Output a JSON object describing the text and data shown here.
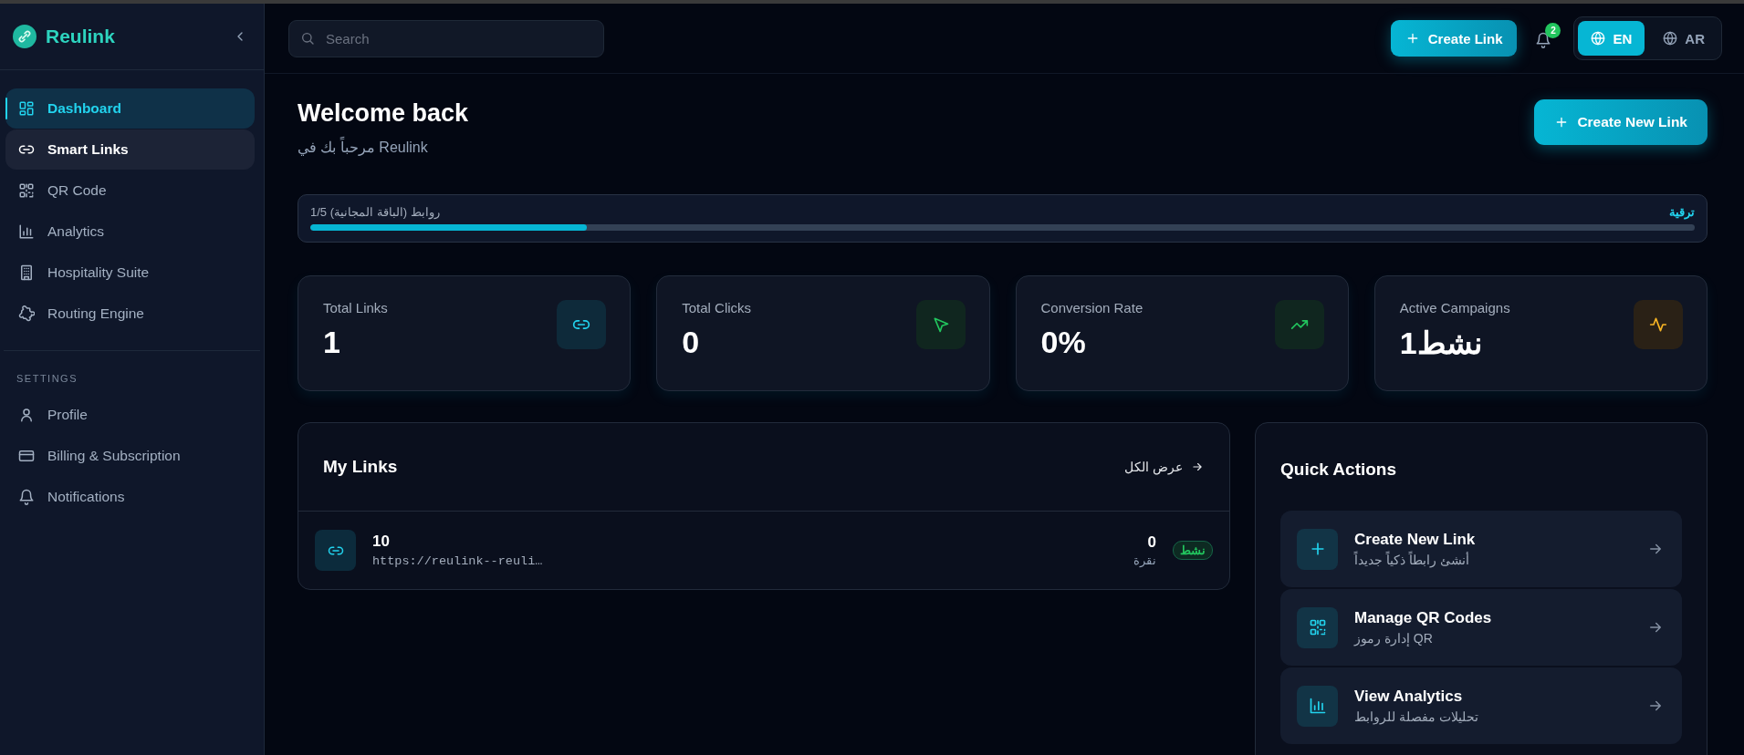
{
  "brand": {
    "name": "Reulink"
  },
  "sidebar": {
    "items": [
      {
        "label": "Dashboard",
        "selected": true,
        "hovered": false
      },
      {
        "label": "Smart Links",
        "selected": false,
        "hovered": true
      },
      {
        "label": "QR Code",
        "selected": false,
        "hovered": false
      },
      {
        "label": "Analytics",
        "selected": false,
        "hovered": false
      },
      {
        "label": "Hospitality Suite",
        "selected": false,
        "hovered": false
      },
      {
        "label": "Routing Engine",
        "selected": false,
        "hovered": false
      }
    ],
    "settings_heading": "SETTINGS",
    "settings_items": [
      {
        "label": "Profile",
        "selected": false
      },
      {
        "label": "Billing & Subscription",
        "selected": false
      },
      {
        "label": "Notifications",
        "selected": false
      }
    ]
  },
  "topbar": {
    "search": {
      "placeholder": "Search"
    },
    "create_button": "Create Link",
    "notification_count": "2",
    "languages": [
      {
        "label": "EN",
        "selected": true
      },
      {
        "label": "AR",
        "selected": false
      }
    ]
  },
  "header": {
    "title": "Welcome back",
    "subtitle": "مرحباً بك في Reulink",
    "button": "Create New Link"
  },
  "plan": {
    "label": "روابط (الباقة المجانية) 1/5",
    "upgrade": "ترقية",
    "level": 0.2
  },
  "stats": [
    {
      "label": "Total Links",
      "value": "1"
    },
    {
      "label": "Total Clicks",
      "value": "0"
    },
    {
      "label": "Conversion Rate",
      "value": "0%"
    },
    {
      "label": "Active Campaigns",
      "value": "نشط1"
    }
  ],
  "my_links": {
    "title": "My Links",
    "view_all": "عرض الكل",
    "rows": [
      {
        "title": "10",
        "url": "https://reulink--reuli…",
        "clicks": "0",
        "clicks_label": "نقرة",
        "status": "نشط"
      }
    ]
  },
  "quick_actions": {
    "title": "Quick Actions",
    "items": [
      {
        "title": "Create New Link",
        "subtitle": "أنشئ رابطاً ذكياً جديداً"
      },
      {
        "title": "Manage QR Codes",
        "subtitle": "إدارة رموز QR"
      },
      {
        "title": "View Analytics",
        "subtitle": "تحليلات مفصلة للروابط"
      }
    ]
  }
}
